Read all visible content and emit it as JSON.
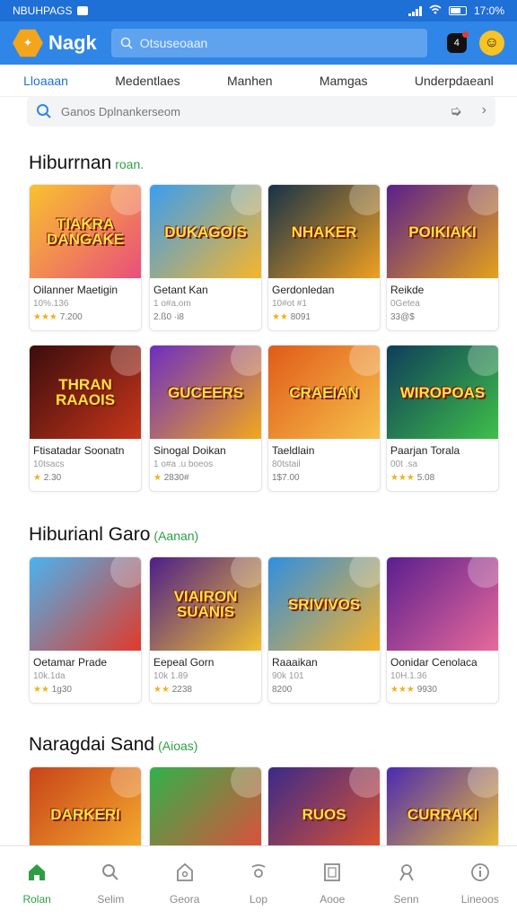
{
  "status_bar": {
    "carrier": "NBUHPAGS",
    "time": "17:0%"
  },
  "app_bar": {
    "logo_text": "Nagk",
    "app_name": "Nagk",
    "search_placeholder": "Otsuseoaan",
    "notification_count": "4"
  },
  "tabs": [
    {
      "label": "Lloaaan",
      "active": true
    },
    {
      "label": "Medentlaes",
      "active": false
    },
    {
      "label": "Manhen",
      "active": false
    },
    {
      "label": "Mamgas",
      "active": false
    },
    {
      "label": "Underpdaeanl",
      "active": false
    }
  ],
  "filter": {
    "placeholder": "Ganos  Dplnankerseom"
  },
  "sections": [
    {
      "title": "Hiburrnan",
      "accent": "roan.",
      "cards": [
        {
          "art_title": "TIAKRA DANGAKE",
          "name": "Oilanner Maetigin",
          "meta": "10%.136",
          "stars": "★★★",
          "rating": "7.200",
          "colors": [
            "#f9c22e",
            "#e94f7a"
          ]
        },
        {
          "art_title": "DUKAGOIS",
          "name": "Getant Kan",
          "meta": "1 o#a.om",
          "stars": "",
          "rating": "2.ß0 ·i8",
          "colors": [
            "#3a9ef0",
            "#f7b52a"
          ]
        },
        {
          "art_title": "NHAKER",
          "name": "Gerdonledan",
          "meta": "10#ot #1",
          "stars": "★★",
          "rating": "8091",
          "colors": [
            "#17324a",
            "#f0a020"
          ]
        },
        {
          "art_title": "POIKIAKI",
          "name": "Reikde",
          "meta": "0Getea",
          "stars": "",
          "rating": "33@$",
          "colors": [
            "#5b1f8c",
            "#e3a21a"
          ]
        }
      ]
    },
    {
      "title": "",
      "accent": "",
      "cards": [
        {
          "art_title": "THRAN RAAOIS",
          "name": "Ftisatadar Soonatn",
          "meta": "10tsacs",
          "stars": "★",
          "rating": "2.30",
          "colors": [
            "#3b0d0d",
            "#c8361b"
          ]
        },
        {
          "art_title": "GUCEERS",
          "name": "Sinogal Doikan",
          "meta": "1 o#a .u boeos",
          "stars": "★",
          "rating": "2830#",
          "colors": [
            "#6d2ec0",
            "#f2a81c"
          ]
        },
        {
          "art_title": "CRAEIAN",
          "name": "Taeldlain",
          "meta": "80tstail",
          "stars": "",
          "rating": "1$7.00",
          "colors": [
            "#e05b1a",
            "#f7c04a"
          ]
        },
        {
          "art_title": "WIROPOAS",
          "name": "Paarjan Torala",
          "meta": "00t .sa",
          "stars": "★★★",
          "rating": "5.08",
          "colors": [
            "#0f3d5a",
            "#3fbf4a"
          ]
        }
      ]
    },
    {
      "title": "Hiburianl Garo",
      "accent": "(Aanan)",
      "cards": [
        {
          "art_title": "",
          "name": "Oetamar Prade",
          "meta": "10k.1da",
          "stars": "★★",
          "rating": "1g30",
          "colors": [
            "#4ab3f0",
            "#e03a2a"
          ]
        },
        {
          "art_title": "VIAIRON SUANIS",
          "name": "Eepeal Gorn",
          "meta": "10k 1.89",
          "stars": "★★",
          "rating": "2238",
          "colors": [
            "#4d1f8a",
            "#f0c030"
          ]
        },
        {
          "art_title": "SRIVIVOS",
          "name": "Raaaikan",
          "meta": "90k 101",
          "stars": "",
          "rating": "8200",
          "colors": [
            "#2f8fe0",
            "#f5b12a"
          ]
        },
        {
          "art_title": "",
          "name": "Oonidar Cenolaca",
          "meta": "10H.1.36",
          "stars": "★★★",
          "rating": "9930",
          "colors": [
            "#5a1e8f",
            "#e86a9a"
          ]
        }
      ]
    },
    {
      "title": "Naragdai Sand",
      "accent": "(Aioas)",
      "cards": [
        {
          "art_title": "DARKERI",
          "name": "",
          "meta": "",
          "stars": "",
          "rating": "",
          "colors": [
            "#c8431a",
            "#f7b02e"
          ]
        },
        {
          "art_title": "",
          "name": "",
          "meta": "",
          "stars": "",
          "rating": "",
          "colors": [
            "#2fb24a",
            "#e84a3a"
          ]
        },
        {
          "art_title": "RUOS",
          "name": "",
          "meta": "",
          "stars": "",
          "rating": "",
          "colors": [
            "#3a2a8a",
            "#e8542a"
          ]
        },
        {
          "art_title": "CURRAKI",
          "name": "",
          "meta": "",
          "stars": "",
          "rating": "",
          "colors": [
            "#4b2ab0",
            "#f5c52e"
          ]
        }
      ]
    }
  ],
  "bottom_nav": [
    {
      "label": "Rolan",
      "icon": "home-icon",
      "active": true
    },
    {
      "label": "Selim",
      "icon": "search-icon",
      "active": false
    },
    {
      "label": "Geora",
      "icon": "store-icon",
      "active": false
    },
    {
      "label": "Lop",
      "icon": "game-icon",
      "active": false
    },
    {
      "label": "Aooe",
      "icon": "library-icon",
      "active": false
    },
    {
      "label": "Senn",
      "icon": "profile-icon",
      "active": false
    },
    {
      "label": "Lineoos",
      "icon": "info-icon",
      "active": false
    }
  ]
}
